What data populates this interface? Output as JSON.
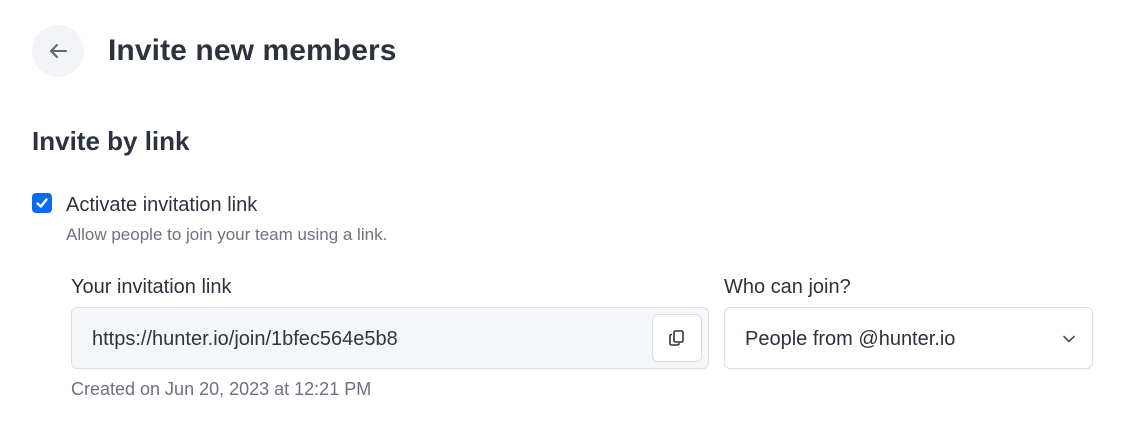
{
  "header": {
    "title": "Invite new members",
    "back_icon": "arrow-left-icon"
  },
  "invite_by_link": {
    "section_title": "Invite by link",
    "activate_checkbox": {
      "label": "Activate invitation link",
      "help": "Allow people to join your team using a link.",
      "checked": true,
      "accent_color": "#0b6bf0"
    },
    "link_field": {
      "label": "Your invitation link",
      "value": "https://hunter.io/join/1bfec564e5b8",
      "copy_icon": "copy-icon"
    },
    "who_can_join": {
      "label": "Who can join?",
      "selected": "People from @hunter.io",
      "chevron_icon": "chevron-down-icon"
    },
    "created_text": "Created on Jun 20, 2023 at 12:21 PM"
  }
}
